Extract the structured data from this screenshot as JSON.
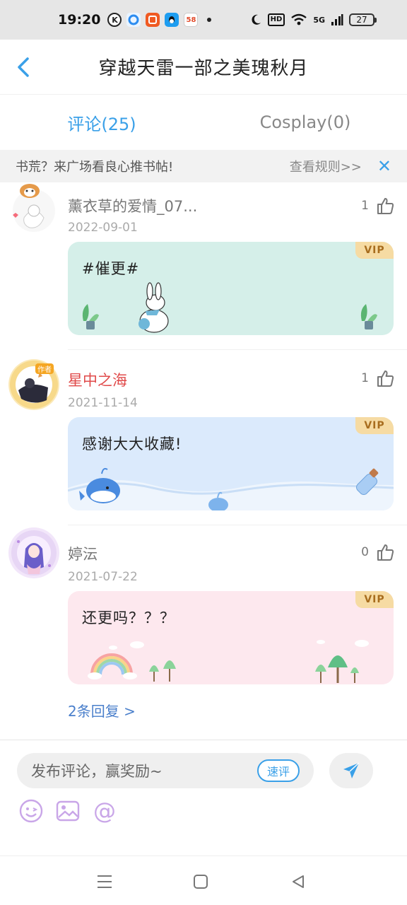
{
  "status_bar": {
    "time": "19:20",
    "apps": [
      {
        "icon": "k-app-icon",
        "label": "K",
        "color": "#222222"
      },
      {
        "icon": "browser-icon",
        "label": "",
        "color": "#2b8cf0"
      },
      {
        "icon": "video-app-icon",
        "label": "",
        "color": "#f05a22"
      },
      {
        "icon": "qq-icon",
        "label": "",
        "color": "#1e9df0"
      },
      {
        "icon": "58-app-icon",
        "label": "58",
        "color": "#f4b400"
      }
    ],
    "network": "5G",
    "battery": "27"
  },
  "header": {
    "title": "穿越天雷一部之美瑰秋月"
  },
  "tabs": [
    {
      "label": "评论(25)",
      "active": true
    },
    {
      "label": "Cosplay(0)",
      "active": false
    }
  ],
  "notice": {
    "text": "书荒？来广场看良心推书帖!",
    "rules_label": "查看规则>>",
    "close_icon": "close-icon"
  },
  "comments": [
    {
      "name": "薰衣草的爱情_07...",
      "date": "2022-09-01",
      "likes": "1",
      "text": "#催更#",
      "vip_label": "VIP",
      "card_color": "#d5efe9",
      "author": false
    },
    {
      "name": "星中之海",
      "date": "2021-11-14",
      "likes": "1",
      "text": "感谢大大收藏!",
      "vip_label": "VIP",
      "card_color": "#dbeafc",
      "author": true,
      "author_badge": "作者"
    },
    {
      "name": "婷沄",
      "date": "2021-07-22",
      "likes": "0",
      "text": "还更吗？？？",
      "vip_label": "VIP",
      "card_color": "#fde8ee",
      "author": false,
      "replies_label": "2条回复 >"
    }
  ],
  "input": {
    "placeholder": "发布评论，赢奖励~",
    "quick_review_label": "速评",
    "send_icon": "send-icon",
    "tools": [
      "emoji-icon",
      "image-icon",
      "at-icon"
    ],
    "at_symbol": "@"
  },
  "colors": {
    "accent": "#3aa0e8",
    "author_name": "#e04a4a",
    "vip_bg": "#f6dba3",
    "vip_text": "#a86d1e",
    "tool_icon": "#c9a6e8"
  }
}
